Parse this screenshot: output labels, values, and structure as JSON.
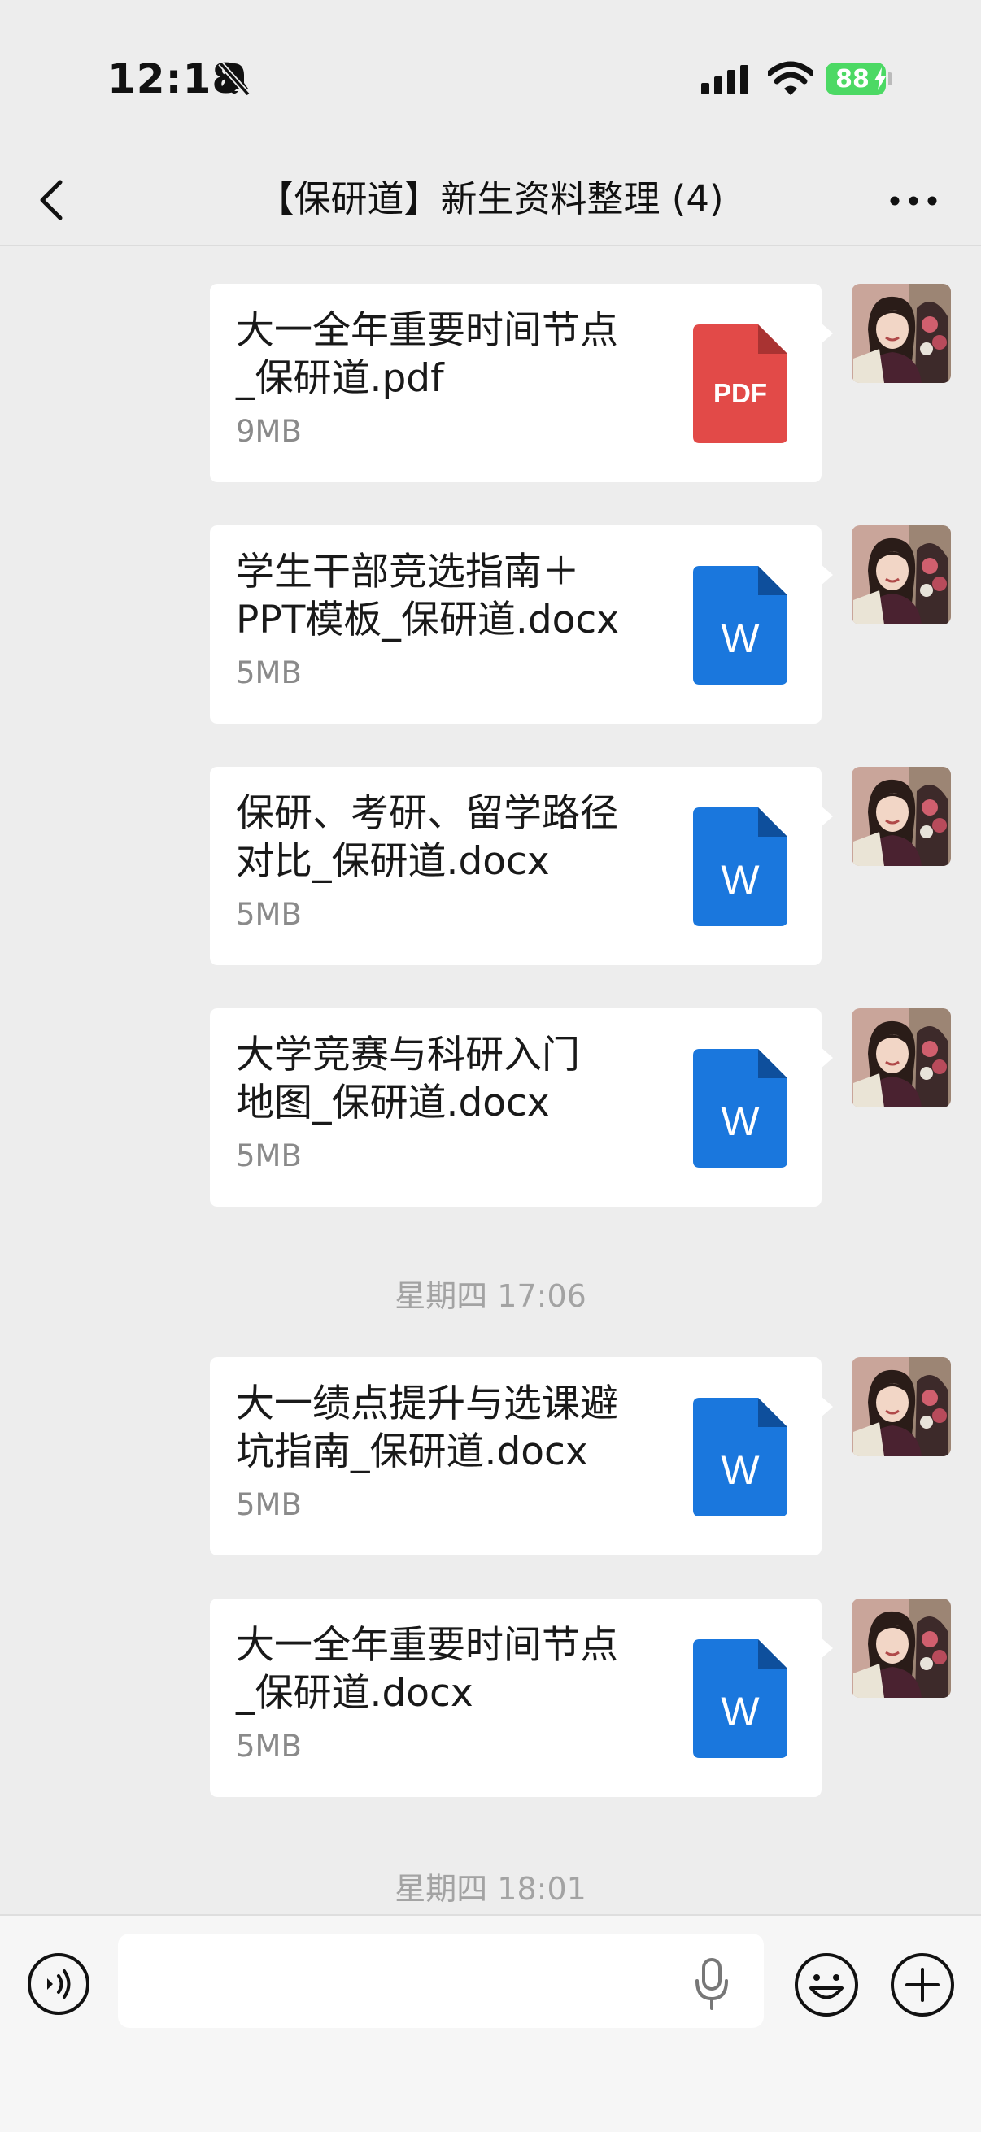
{
  "status_bar": {
    "time": "12:18",
    "battery": "88"
  },
  "header": {
    "title": "【保研道】新生资料整理 (4)"
  },
  "file_icons": {
    "pdf": "PDF",
    "word": "W"
  },
  "messages": [
    {
      "name": "大一全年重要时间节点\n_保研道.pdf",
      "size": "9MB",
      "type": "pdf"
    },
    {
      "name": "学生干部竞选指南＋\nPPT模板_保研道.docx",
      "size": "5MB",
      "type": "word"
    },
    {
      "name": "保研、考研、留学路径\n对比_保研道.docx",
      "size": "5MB",
      "type": "word"
    },
    {
      "name": "大学竞赛与科研入门\n地图_保研道.docx",
      "size": "5MB",
      "type": "word"
    },
    {
      "name": "大一绩点提升与选课避\n坑指南_保研道.docx",
      "size": "5MB",
      "type": "word"
    },
    {
      "name": "大一全年重要时间节点\n_保研道.docx",
      "size": "5MB",
      "type": "word"
    }
  ],
  "timestamps": [
    "星期四 17:06",
    "星期四 18:01"
  ],
  "colors": {
    "pdf": "#e24a48",
    "word": "#1a77dd",
    "battery": "#4cd964",
    "background": "#ededed"
  },
  "icons": [
    "mute-icon",
    "signal-icon",
    "wifi-icon",
    "battery-icon",
    "back-icon",
    "more-icon",
    "voice-icon",
    "microphone-icon",
    "emoji-icon",
    "plus-icon"
  ]
}
